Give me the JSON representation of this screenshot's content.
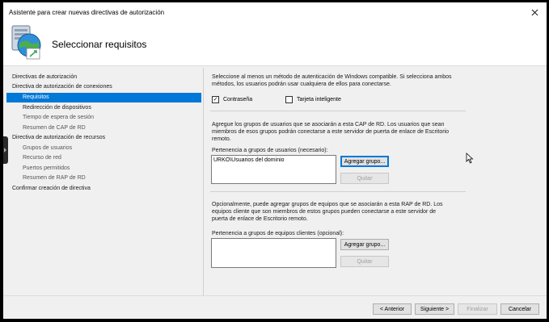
{
  "window": {
    "title": "Asistente para crear nuevas directivas de autorización"
  },
  "header": {
    "title": "Seleccionar requisitos",
    "icon": "network-globe-icon"
  },
  "nav": {
    "items": [
      {
        "label": "Directivas de autorización",
        "level": 0,
        "selected": false
      },
      {
        "label": "Directiva de autorización de conexiones",
        "level": 0,
        "selected": false
      },
      {
        "label": "Requisitos",
        "level": 1,
        "selected": true
      },
      {
        "label": "Redirección de dispositivos",
        "level": 1,
        "selected": false
      },
      {
        "label": "Tiempo de espera de sesión",
        "level": 1,
        "selected": false
      },
      {
        "label": "Resumen de CAP de RD",
        "level": 1,
        "selected": false
      },
      {
        "label": "Directiva de autorización de recursos",
        "level": 0,
        "selected": false
      },
      {
        "label": "Grupos de usuarios",
        "level": 1,
        "selected": false
      },
      {
        "label": "Recurso de red",
        "level": 1,
        "selected": false
      },
      {
        "label": "Puertos permitidos",
        "level": 1,
        "selected": false
      },
      {
        "label": "Resumen de RAP de RD",
        "level": 1,
        "selected": false
      },
      {
        "label": "Confirmar creación de directiva",
        "level": 0,
        "selected": false
      }
    ]
  },
  "content": {
    "auth_intro_line1": "Seleccione al menos un método de autenticación de Windows compatible. Si selecciona ambos",
    "auth_intro_line2": "métodos, los usuarios podrán usar cualquiera de ellos para conectarse.",
    "password_label": "Contraseña",
    "password_checked": true,
    "smartcard_label": "Tarjeta inteligente",
    "smartcard_checked": false,
    "user_groups_intro_line1": "Agregue los grupos de usuarios que se asociarán a esta CAP de RD. Los usuarios que sean",
    "user_groups_intro_line2": "miembros de esos grupos podrán conectarse a este servidor de puerta de enlace de Escritorio",
    "user_groups_intro_line3": "remoto.",
    "user_groups_label": "Pertenencia a grupos de usuarios (necesario):",
    "user_groups": [
      "URKO\\Usuarios del dominio"
    ],
    "add_group_label": "Agregar grupo...",
    "remove_label": "Quitar",
    "computer_groups_intro_line1": "Opcionalmente, puede agregar grupos de equipos que se asociarán a esta RAP de RD. Los",
    "computer_groups_intro_line2": "equipos cliente que son miembros de estos grupos pueden conectarse a este servidor de",
    "computer_groups_intro_line3": "puerta de enlace de Escritorio remoto.",
    "computer_groups_label": "Pertenencia a grupos de equipos clientes (opcional):",
    "computer_groups": [],
    "add_computer_group_label": "Agregar grupo...",
    "remove_computer_label": "Quitar"
  },
  "footer": {
    "back_label": "< Anterior",
    "next_label": "Siguiente >",
    "finish_label": "Finalizar",
    "cancel_label": "Cancelar"
  },
  "colors": {
    "selection": "#0078d7",
    "window_bg": "#f0f0f0"
  }
}
